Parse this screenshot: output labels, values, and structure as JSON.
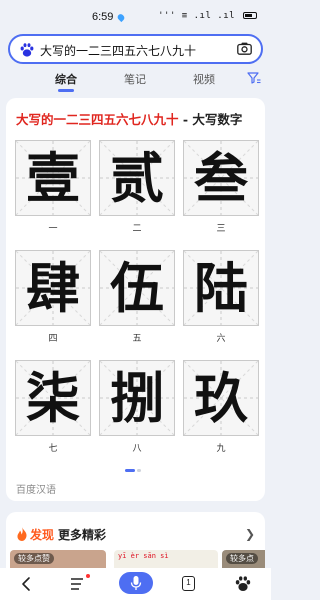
{
  "status_bar": {
    "time": "6:59",
    "signal_text": "''' ≡ .ıl .ıl"
  },
  "search": {
    "query": "大写的一二三四五六七八九十"
  },
  "tabs": [
    {
      "label": "综合",
      "active": true
    },
    {
      "label": "笔记",
      "active": false
    },
    {
      "label": "视频",
      "active": false
    }
  ],
  "card": {
    "title_red": "大写的一二三四五六七八九十",
    "title_rest": " - 大写数字",
    "cells": [
      {
        "glyph": "壹",
        "num": "一"
      },
      {
        "glyph": "贰",
        "num": "二"
      },
      {
        "glyph": "叁",
        "num": "三"
      },
      {
        "glyph": "肆",
        "num": "四"
      },
      {
        "glyph": "伍",
        "num": "五"
      },
      {
        "glyph": "陆",
        "num": "六"
      },
      {
        "glyph": "柒",
        "num": "七"
      },
      {
        "glyph": "捌",
        "num": "八"
      },
      {
        "glyph": "玖",
        "num": "九"
      }
    ],
    "source": "百度汉语"
  },
  "discover": {
    "label_find": "发现",
    "label_more": "更多精彩",
    "thumb1_badge": "较多点赞",
    "thumb2_pinyin": "yī  èr  sān  sì",
    "thumb3_badge": "较多点"
  },
  "bottom_nav": {
    "tab_count": "1"
  },
  "colors": {
    "accent": "#4e6ef2",
    "title_red": "#e0261f",
    "discover_orange": "#ff5a1f"
  }
}
